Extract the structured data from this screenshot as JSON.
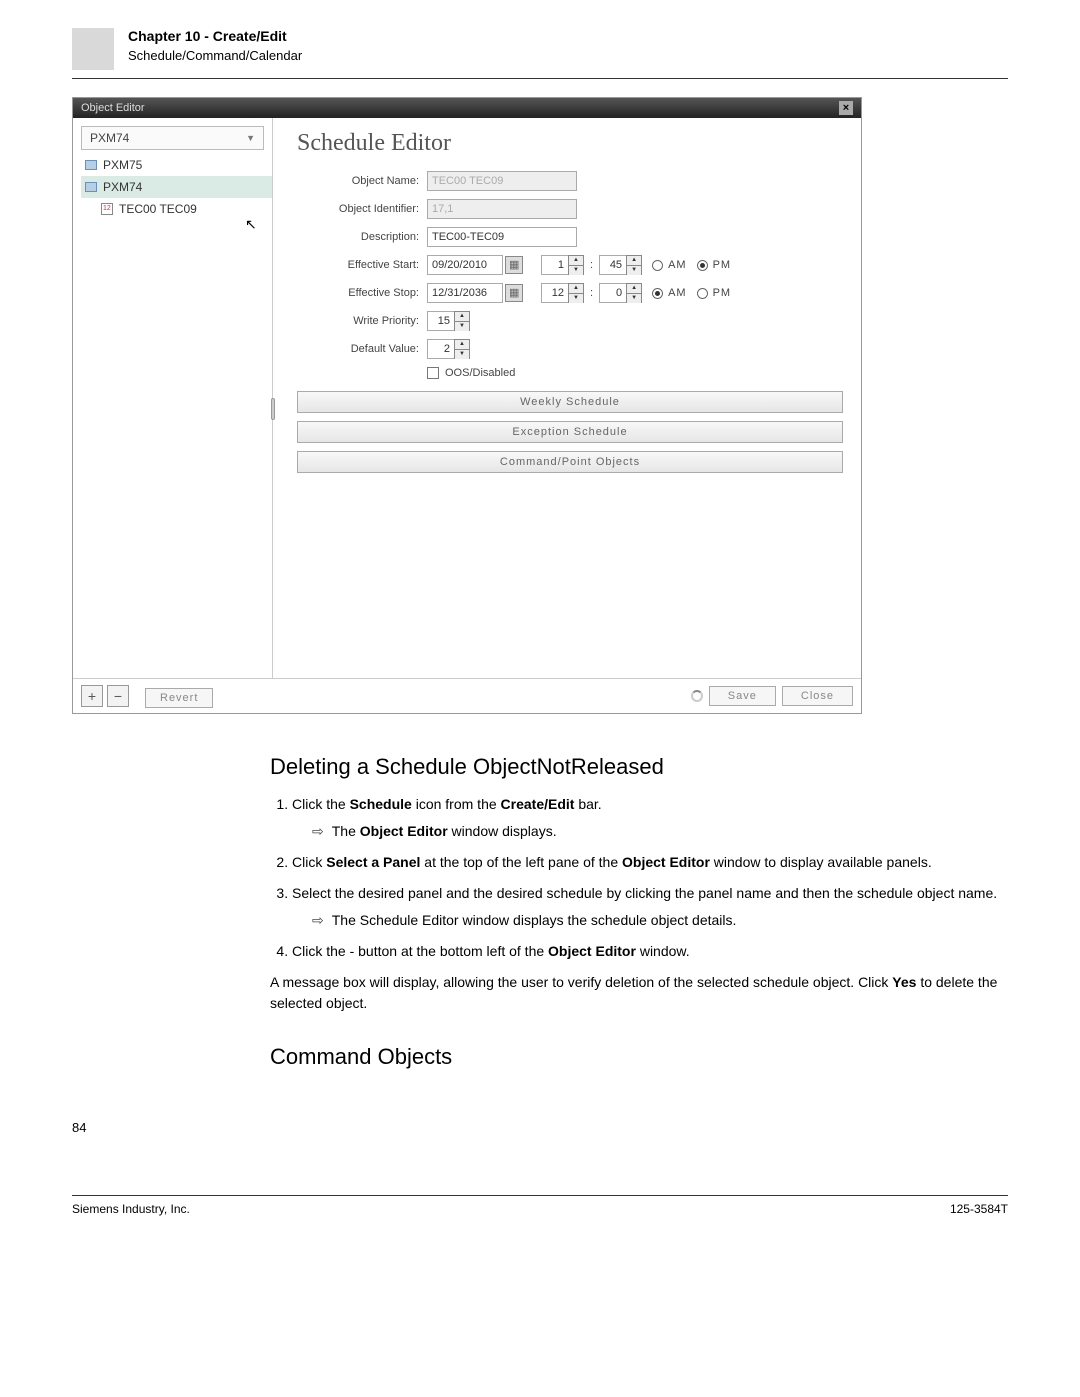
{
  "header": {
    "chapter": "Chapter 10 - Create/Edit",
    "sub": "Schedule/Command/Calendar"
  },
  "objectEditor": {
    "title": "Object Editor",
    "close": "×",
    "panelSelect": "PXM74",
    "tree": {
      "n0": "PXM75",
      "n1": "PXM74",
      "n2": "TEC00 TEC09"
    },
    "seTitle": "Schedule Editor",
    "labels": {
      "objectName": "Object Name:",
      "objectId": "Object Identifier:",
      "description": "Description:",
      "effStart": "Effective Start:",
      "effStop": "Effective Stop:",
      "writePriority": "Write Priority:",
      "defaultValue": "Default Value:",
      "oos": "OOS/Disabled",
      "am": "AM",
      "pm": "PM"
    },
    "values": {
      "objectName": "TEC00 TEC09",
      "objectId": "17,1",
      "description": "TEC00-TEC09",
      "startDate": "09/20/2010",
      "startHour": "1",
      "startMin": "45",
      "stopDate": "12/31/2036",
      "stopHour": "12",
      "stopMin": "0",
      "writePriority": "15",
      "defaultValue": "2"
    },
    "buttons": {
      "weekly": "Weekly Schedule",
      "exception": "Exception Schedule",
      "cmdpoint": "Command/Point Objects",
      "add": "+",
      "remove": "−",
      "revert": "Revert",
      "save": "Save",
      "close": "Close"
    }
  },
  "doc": {
    "h2_1": "Deleting a Schedule ObjectNotReleased",
    "s1_a": "Click the ",
    "s1_b": "Schedule",
    "s1_c": " icon from the ",
    "s1_d": "Create/Edit",
    "s1_e": " bar.",
    "r1_a": "The ",
    "r1_b": "Object Editor",
    "r1_c": " window displays.",
    "s2_a": "Click ",
    "s2_b": "Select a Panel",
    "s2_c": " at the top of the left pane of the ",
    "s2_d": "Object Editor",
    "s2_e": " window to display available panels.",
    "s3": "Select the desired panel and the desired schedule by clicking the panel name and then the schedule object name.",
    "r3": "The Schedule Editor window displays the schedule object details.",
    "s4_a": "Click the - button at the bottom left of the ",
    "s4_b": "Object Editor",
    "s4_c": " window.",
    "p1_a": "A message box will display, allowing the user to verify deletion of the selected schedule object. Click ",
    "p1_b": "Yes",
    "p1_c": " to delete the selected object.",
    "h2_2": "Command Objects"
  },
  "footer": {
    "pageNum": "84",
    "left": "Siemens Industry, Inc.",
    "right": "125-3584T"
  }
}
